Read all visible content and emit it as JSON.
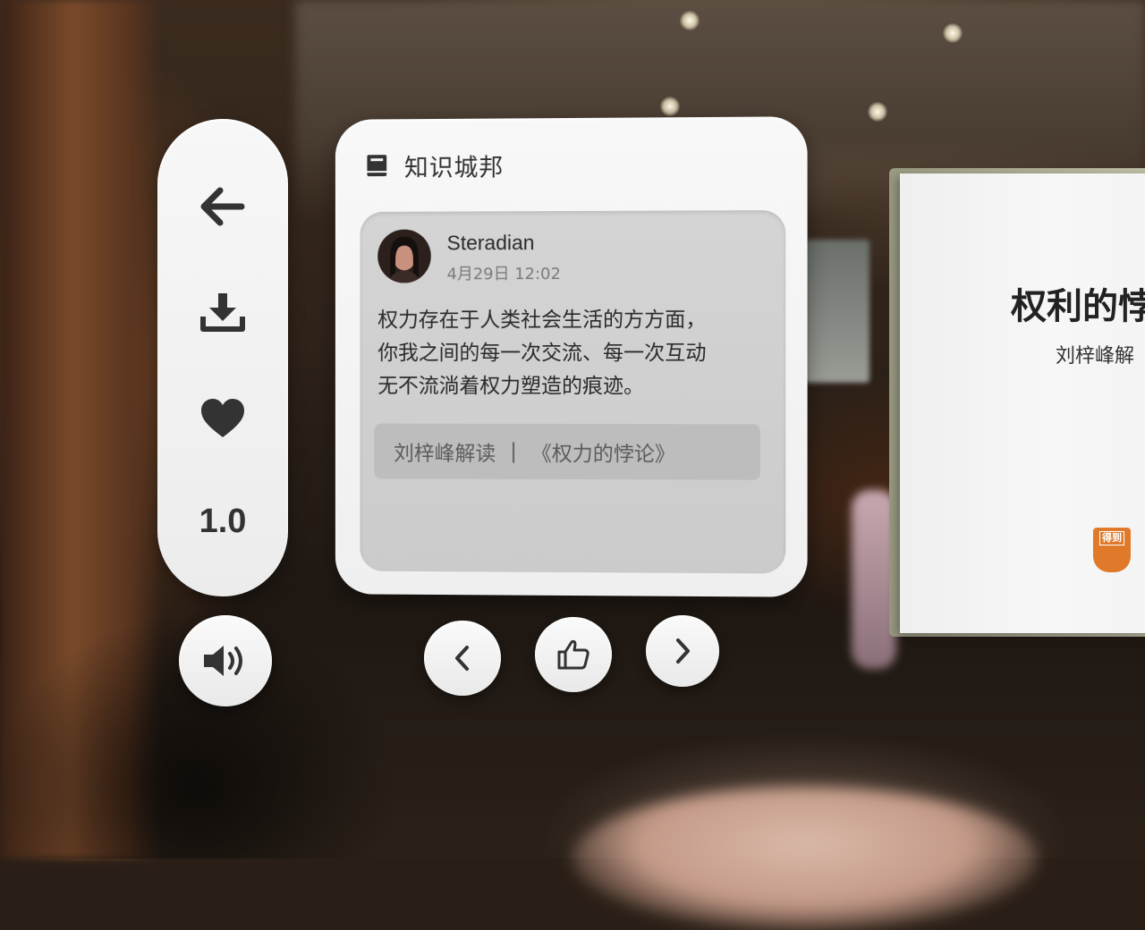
{
  "app": {
    "title": "知识城邦"
  },
  "controls": {
    "speed": "1.0"
  },
  "post": {
    "author": "Steradian",
    "time": "4月29日 12:02",
    "text": "权力存在于人类社会生活的方方面，\n你我之间的每一次交流、每一次互动\n无不流淌着权力塑造的痕迹。",
    "source_author": "刘梓峰解读",
    "source_separator": "|",
    "source_book": "《权力的悖论》"
  },
  "book": {
    "title": "权利的悖",
    "subtitle": "刘梓峰解",
    "logo_text": "得到"
  },
  "colors": {
    "panel": "#f4f4f4",
    "icon": "#333333",
    "post_box": "#cfcfcf",
    "source_tag": "#bdbdbd",
    "logo": "#e07a2a"
  },
  "icons": {
    "back": "arrow-left-icon",
    "download": "download-icon",
    "favorite": "heart-icon",
    "volume": "volume-icon",
    "prev": "chevron-left-icon",
    "like": "thumbs-up-icon",
    "next": "chevron-right-icon",
    "app": "book-icon"
  }
}
